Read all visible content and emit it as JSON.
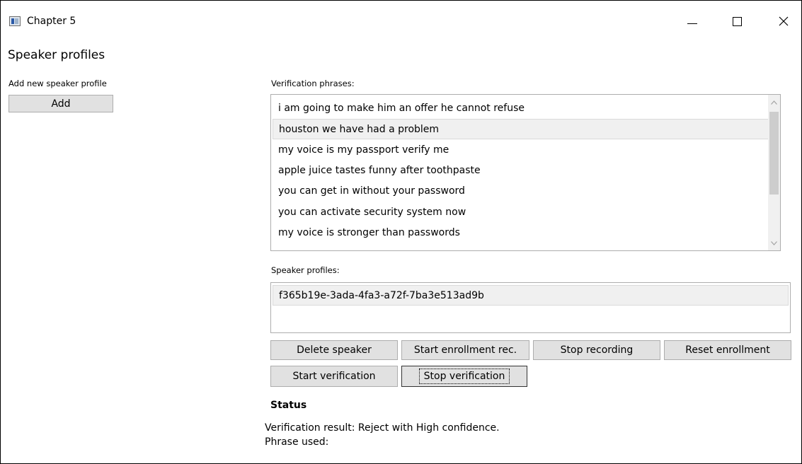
{
  "window": {
    "title": "Chapter 5",
    "controls": {
      "minimize": "minimize",
      "maximize": "maximize",
      "close": "close"
    }
  },
  "page": {
    "heading": "Speaker profiles",
    "add_section": {
      "label": "Add new speaker profile",
      "button": "Add"
    }
  },
  "phrases": {
    "label": "Verification phrases:",
    "items": [
      "i am going to make him an offer he cannot refuse",
      "houston we have had a problem",
      "my voice is my passport verify me",
      "apple juice tastes funny after toothpaste",
      "you can get in without your password",
      "you can activate security system now",
      "my voice is stronger than passwords"
    ],
    "selected_index": 1
  },
  "profiles": {
    "label": "Speaker profiles:",
    "items": [
      "f365b19e-3ada-4fa3-a72f-7ba3e513ad9b"
    ]
  },
  "buttons": {
    "delete_speaker": "Delete speaker",
    "start_enrollment": "Start enrollment rec.",
    "stop_recording": "Stop recording",
    "reset_enrollment": "Reset enrollment",
    "start_verification": "Start verification",
    "stop_verification": "Stop verification"
  },
  "status": {
    "title": "Status",
    "verification_result": "Verification result: Reject with High confidence.",
    "phrase_used": "Phrase used:"
  },
  "icons": {
    "app": "app-window-icon",
    "scroll_up": "chevron-up-icon",
    "scroll_down": "chevron-down-icon"
  }
}
